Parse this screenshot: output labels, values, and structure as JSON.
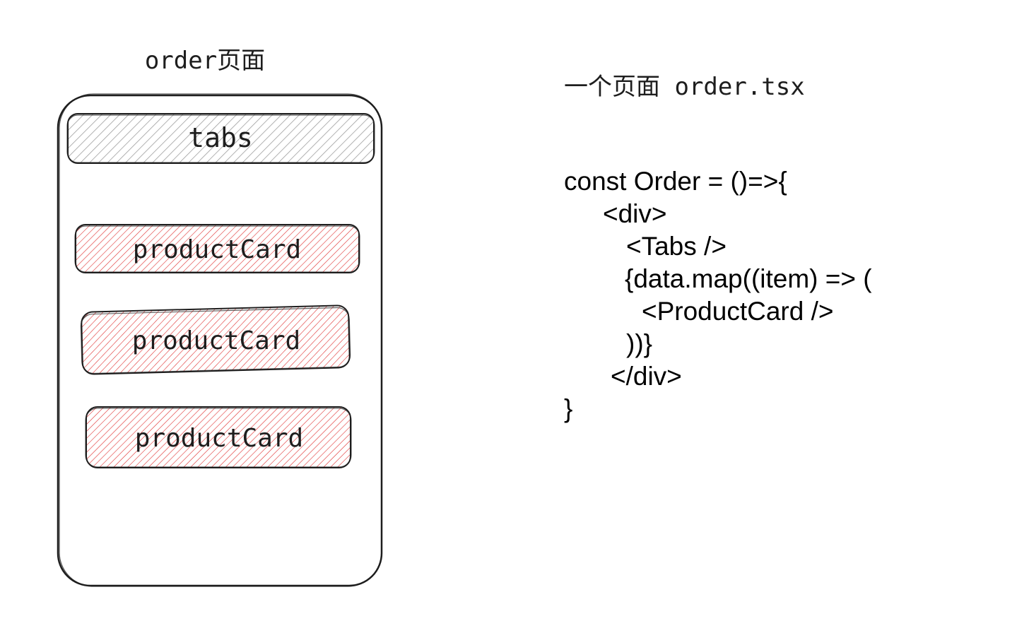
{
  "page_title": "order页面",
  "heading": "一个页面 order.tsx",
  "tabs_label": "tabs",
  "cards": [
    {
      "label": "productCard"
    },
    {
      "label": "productCard"
    },
    {
      "label": "productCard"
    }
  ],
  "code_lines": [
    "const Order = ()=>{",
    "<div>",
    "<Tabs />",
    "{data.map((item) => (",
    "<ProductCard />",
    "))}",
    "</div>",
    "}"
  ],
  "colors": {
    "stroke": "#1e1e1e",
    "tabs_hatch": "#9e9e9e",
    "card_hatch": "#e03131"
  }
}
